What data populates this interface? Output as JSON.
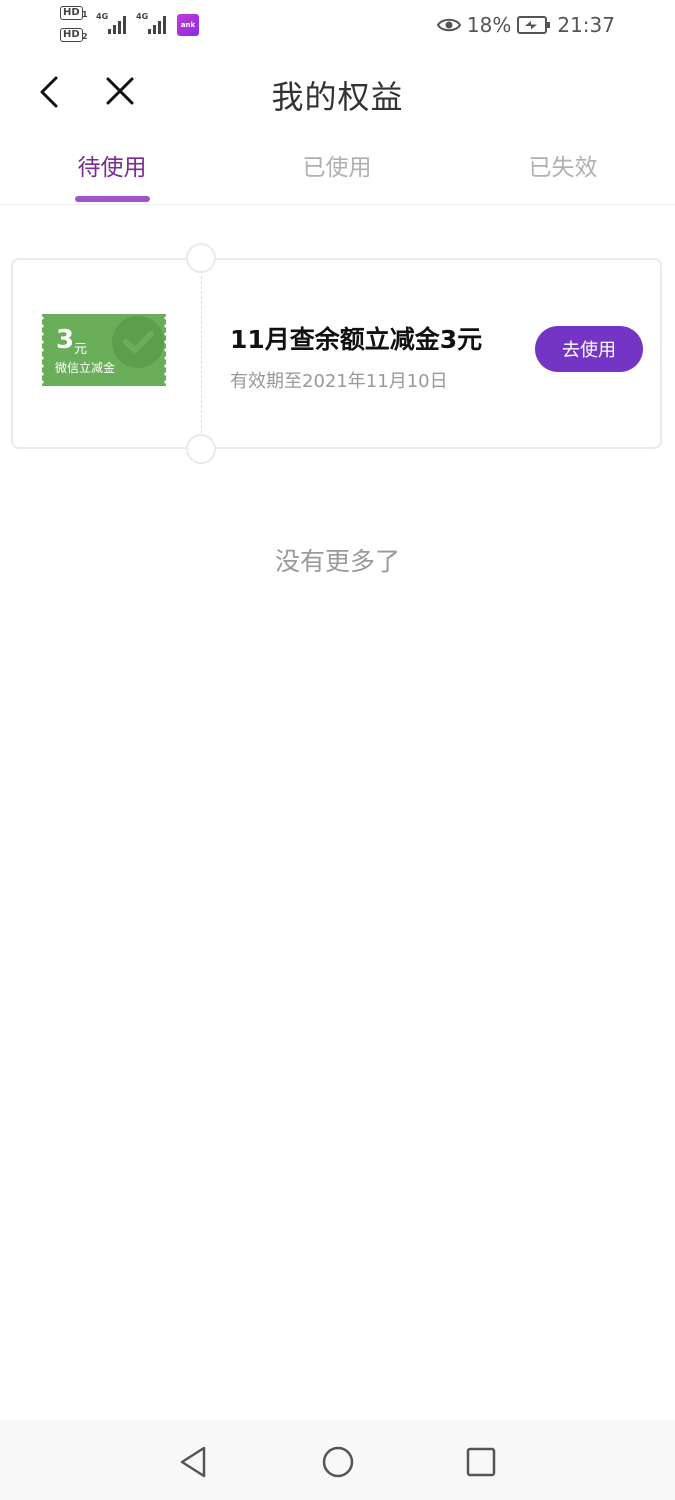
{
  "status_bar": {
    "hd1": "HD",
    "hd1_sub": "1",
    "hd2": "HD",
    "hd2_sub": "2",
    "net1": "4G",
    "net2": "4G",
    "bank_icon_text": "ank",
    "eye_icon": "eye-icon",
    "battery_percent": "18%",
    "battery_icon": "battery-charging-icon",
    "time": "21:37"
  },
  "nav": {
    "back_icon": "chevron-left-icon",
    "close_icon": "close-icon",
    "title": "我的权益"
  },
  "tabs": [
    {
      "label": "待使用",
      "active": true
    },
    {
      "label": "已使用",
      "active": false
    },
    {
      "label": "已失效",
      "active": false
    }
  ],
  "coupon": {
    "ticket_amount": "3",
    "ticket_unit": "元",
    "ticket_caption": "微信立减金",
    "title": "11月查余额立减金3元",
    "expiry": "有效期至2021年11月10日",
    "button_label": "去使用"
  },
  "empty_hint": "没有更多了",
  "colors": {
    "accent_purple": "#7435c6",
    "tab_active_text": "#7b2c8f",
    "tab_underline": "#a055c8",
    "ticket_green": "#6aae5a"
  },
  "system_nav": {
    "back": "triangle-back-icon",
    "home": "circle-home-icon",
    "recents": "square-recents-icon"
  }
}
